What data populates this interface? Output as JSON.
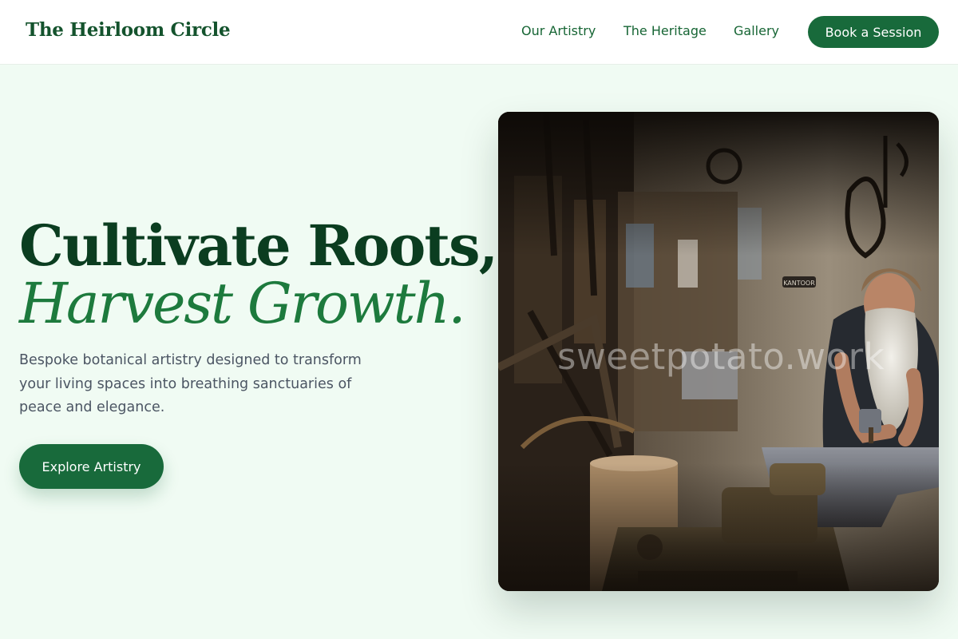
{
  "header": {
    "brand": "The Heirloom Circle",
    "nav": [
      {
        "label": "Our Artistry"
      },
      {
        "label": "The Heritage"
      },
      {
        "label": "Gallery"
      }
    ],
    "cta_label": "Book a Session"
  },
  "hero": {
    "title_line1": "Cultivate Roots,",
    "title_line2": "Harvest Growth.",
    "description": "Bespoke botanical artistry designed to transform your living spaces into breathing sanctuaries of peace and elegance.",
    "cta_label": "Explore Artistry",
    "image": {
      "subject": "blacksmith-at-anvil-photo",
      "watermark": "sweetpotato.work",
      "sign_text": "KANTOOR"
    }
  },
  "colors": {
    "page_background": "#f0fbf3",
    "brand_green": "#186a3b",
    "title_dark_green": "#0b3d20",
    "title_accent_green": "#1d7a3d",
    "body_text": "#4b5563"
  }
}
